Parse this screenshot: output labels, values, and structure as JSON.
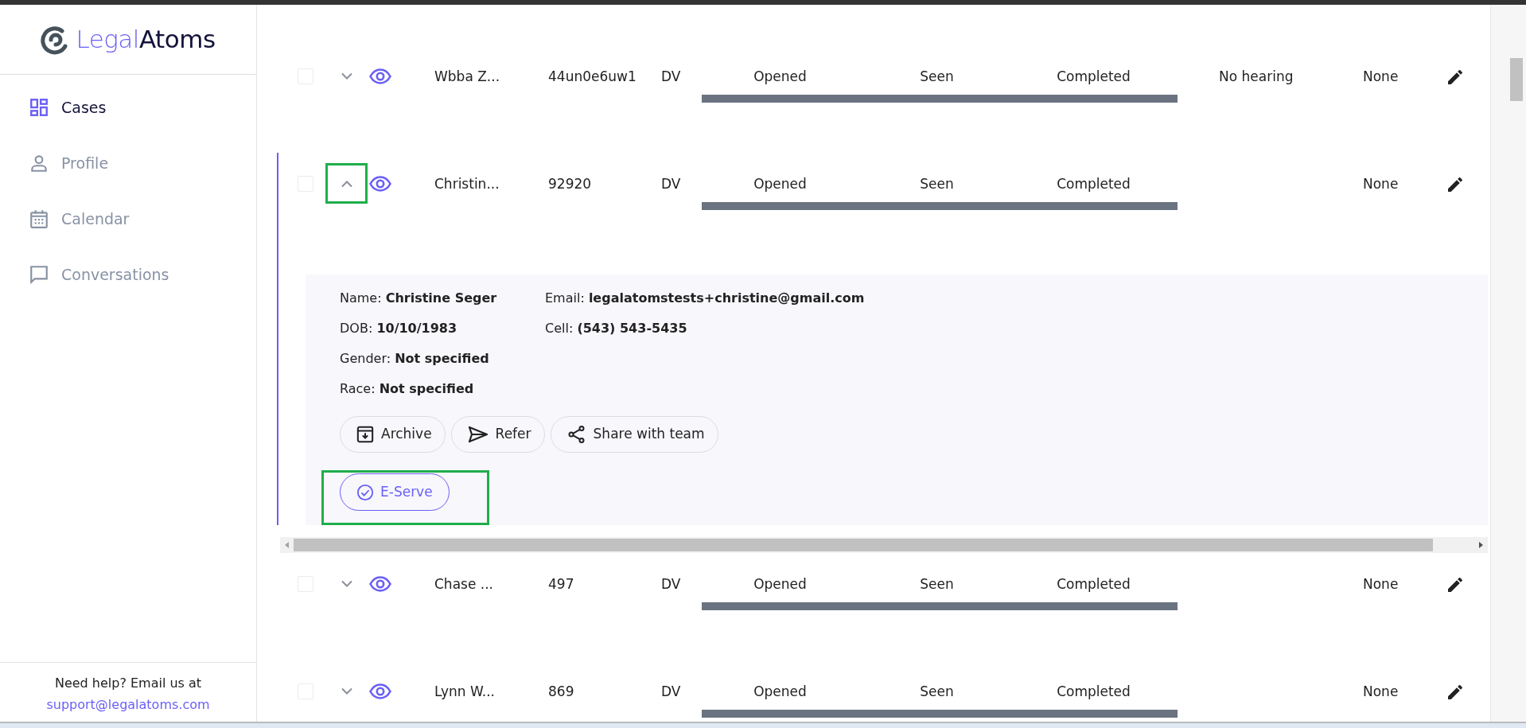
{
  "brand": {
    "light": "Legal",
    "strong": "Atoms"
  },
  "nav": [
    {
      "label": "Cases",
      "selected": true
    },
    {
      "label": "Profile",
      "selected": false
    },
    {
      "label": "Calendar",
      "selected": false
    },
    {
      "label": "Conversations",
      "selected": false
    }
  ],
  "help": {
    "text": "Need help? Email us at",
    "link": "support@legalatoms.com"
  },
  "rows": [
    {
      "checked": false,
      "expanded": false,
      "highlighted": false,
      "name": "Wbba Z...",
      "case_id": "44un0e6uw1",
      "type": "DV",
      "steps": [
        "Opened",
        "Seen",
        "Completed"
      ],
      "level": 1,
      "hearing": "No hearing",
      "status": "None"
    },
    {
      "checked": false,
      "expanded": true,
      "highlighted": true,
      "name": "Christin...",
      "case_id": "92920",
      "type": "DV",
      "steps": [
        "Opened",
        "Seen",
        "Completed"
      ],
      "level": 1,
      "status": "None",
      "details": {
        "columns": [
          [
            "Name: **Christine Seger**",
            "DOB: **10/10/1983**",
            "Gender: **Not specified**",
            "Race: **Not specified**"
          ],
          [
            "Email: **legalatomstests+christine@gmail.com**",
            "Cell: **(543) 543-5435**"
          ]
        ],
        "actions": [
          {
            "label": "Archive"
          },
          {
            "label": "Refer"
          },
          {
            "label": "Share with team"
          }
        ],
        "eserve": {
          "label": "E-Serve",
          "highlighted": true
        }
      }
    },
    {
      "checked": false,
      "expanded": false,
      "highlighted": false,
      "name": "Chase ...",
      "case_id": "497",
      "type": "DV",
      "steps": [
        "Opened",
        "Seen",
        "Completed"
      ],
      "level": 1,
      "status": "None"
    },
    {
      "checked": false,
      "expanded": false,
      "highlighted": false,
      "name": "Lynn W...",
      "case_id": "869",
      "type": "DV",
      "steps": [
        "Opened",
        "Seen",
        "Completed"
      ],
      "level": 1,
      "status": "None"
    }
  ]
}
